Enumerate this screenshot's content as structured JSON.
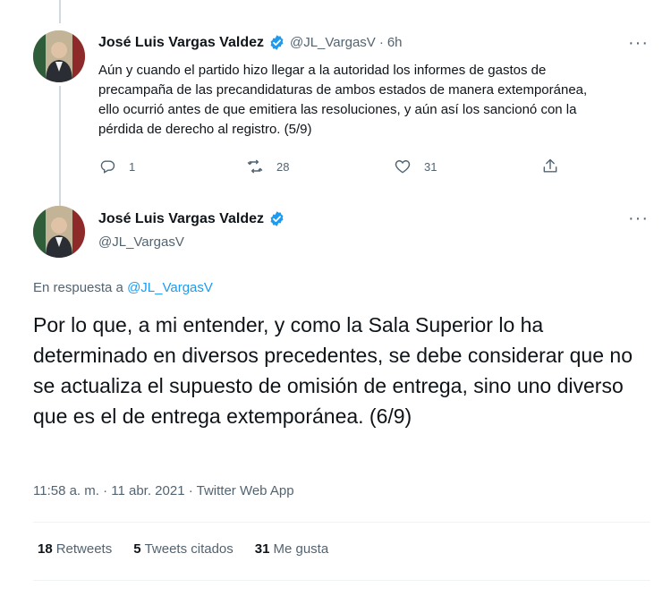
{
  "tweet1": {
    "author_name": "José Luis Vargas Valdez",
    "handle": "@JL_VargasV",
    "separator": "·",
    "time": "6h",
    "text": "Aún y cuando el partido hizo llegar a la autoridad los informes de gastos de precampaña de las precandidaturas de ambos estados de manera extemporánea, ello ocurrió antes de que emitiera las resoluciones, y aún así los sancionó con la pérdida de derecho al registro. (5/9)",
    "replies": "1",
    "retweets": "28",
    "likes": "31"
  },
  "tweet2": {
    "author_name": "José Luis Vargas Valdez",
    "handle": "@JL_VargasV",
    "reply_prefix": "En respuesta a",
    "reply_to": "@JL_VargasV",
    "text": "Por lo que, a mi entender, y como la Sala Superior lo ha determinado en diversos precedentes, se debe considerar que no se actualiza el supuesto de omisión de entrega, sino uno diverso que es el de entrega extemporánea. (6/9)",
    "meta": "11:58 a. m. · 11 abr. 2021 · Twitter Web App",
    "stats": [
      {
        "count": "18",
        "label": "Retweets"
      },
      {
        "count": "5",
        "label": "Tweets citados"
      },
      {
        "count": "31",
        "label": "Me gusta"
      }
    ]
  },
  "more_icon": "···",
  "colors": {
    "accent": "#1d9bf0",
    "secondary_text": "#536471",
    "primary_text": "#0f1419",
    "divider": "#eff3f4"
  }
}
